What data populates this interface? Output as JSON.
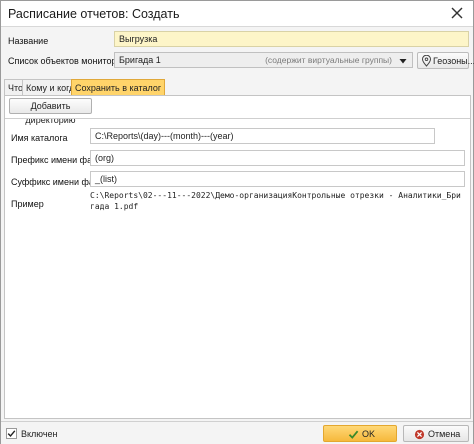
{
  "window": {
    "title": "Расписание отчетов: Создать"
  },
  "form": {
    "name_label": "Название",
    "name_value": "Выгрузка",
    "objects_label": "Список объектов мониторинга",
    "objects_value": "Бригада 1",
    "objects_hint": "(содержит виртуальные группы)",
    "geozones_label": "Геозоны..."
  },
  "tabs": [
    {
      "label": "Что",
      "active": false
    },
    {
      "label": "Кому и когда",
      "active": false
    },
    {
      "label": "Сохранить в каталог",
      "active": true
    }
  ],
  "catalog": {
    "add_dir_label": "Добавить директорию",
    "dir_name_label": "Имя каталога",
    "dir_name_value": "C:\\Reports\\(day)---(month)---(year)",
    "prefix_label": "Префикс имени файла",
    "prefix_value": "(org)",
    "suffix_label": "Суффикс имени файла",
    "suffix_value": "_(list)",
    "example_label": "Пример",
    "example_value": "C:\\Reports\\02---11---2022\\Демо-организацияКонтрольные отрезки - Аналитики_Бригада 1.pdf"
  },
  "footer": {
    "enabled_label": "Включен",
    "enabled": true,
    "ok_label": "OK",
    "cancel_label": "Отмена"
  },
  "colors": {
    "accent": "#ffd46a",
    "name_field_bg": "#fdf5c8",
    "ok_icon": "#3a8a2a",
    "cancel_icon": "#c0392b"
  },
  "icons": [
    "close-icon",
    "chevron-down-icon",
    "geozone-pin-icon",
    "checkmark-icon",
    "cancel-icon"
  ]
}
